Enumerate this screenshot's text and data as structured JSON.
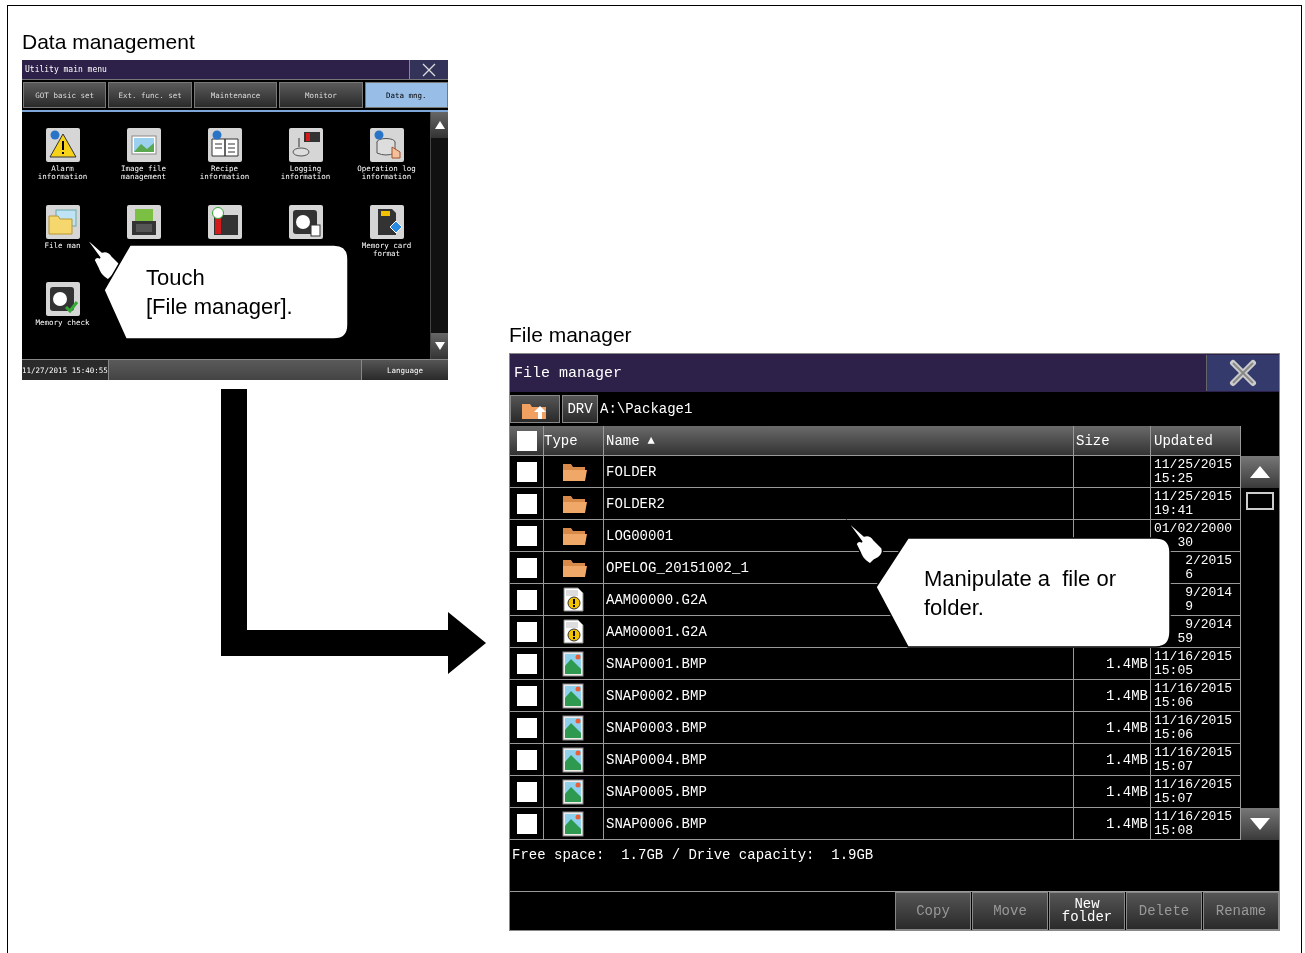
{
  "data_management": {
    "caption": "Data management",
    "screen": {
      "title": "Utility main menu",
      "tabs": [
        {
          "label": "GOT basic set",
          "selected": false
        },
        {
          "label": "Ext. func. set",
          "selected": false
        },
        {
          "label": "Maintenance",
          "selected": false
        },
        {
          "label": "Monitor",
          "selected": false
        },
        {
          "label": "Data mng.",
          "selected": true
        }
      ],
      "items": [
        {
          "kind": "alarm",
          "label": [
            "Alarm",
            "information"
          ]
        },
        {
          "kind": "image",
          "label": [
            "Image file",
            "management"
          ]
        },
        {
          "kind": "recipe",
          "label": [
            "Recipe",
            "information"
          ]
        },
        {
          "kind": "logging",
          "label": [
            "Logging",
            "information"
          ]
        },
        {
          "kind": "oplog",
          "label": [
            "Operation log",
            "information"
          ]
        },
        {
          "kind": "file",
          "label": [
            "File man"
          ]
        },
        {
          "kind": "hardcopy"
        },
        {
          "kind": "timer"
        },
        {
          "kind": "disk"
        },
        {
          "kind": "card",
          "label": [
            "Memory card",
            "format"
          ]
        },
        {
          "kind": "check",
          "label": [
            "Memory check"
          ]
        }
      ],
      "datetime": "11/27/2015 15:40:55",
      "language_button": "Language"
    },
    "callout": [
      "Touch",
      "[File manager]."
    ]
  },
  "file_manager": {
    "caption": "File manager",
    "screen": {
      "title": "File manager",
      "drive_button": "DRV",
      "path": "A:\\Package1",
      "select_all_checked": false,
      "columns": [
        "Type",
        "Name",
        "Size",
        "Updated"
      ],
      "sort_indicator": "▲",
      "rows": [
        {
          "kind": "folder",
          "checked": false,
          "name": "FOLDER",
          "updated": [
            "11/25/2015",
            "15:25"
          ]
        },
        {
          "kind": "folder",
          "checked": false,
          "name": "FOLDER2",
          "updated": [
            "11/25/2015",
            "19:41"
          ]
        },
        {
          "kind": "folder",
          "checked": false,
          "name": "LOG00001",
          "updated": [
            "01/02/2000",
            "30"
          ]
        },
        {
          "kind": "folder",
          "checked": false,
          "name": "OPELOG_20151002_1",
          "updated": [
            "2/2015",
            "6"
          ]
        },
        {
          "kind": "alarm-file",
          "checked": false,
          "name": "AAM00000.G2A",
          "updated": [
            "9/2014",
            "9"
          ]
        },
        {
          "kind": "alarm-file",
          "checked": false,
          "name": "AAM00001.G2A",
          "updated": [
            "9/2014",
            "59"
          ]
        },
        {
          "kind": "image-file",
          "checked": false,
          "name": "SNAP0001.BMP",
          "size": "1.4MB",
          "updated": [
            "11/16/2015",
            "15:05"
          ]
        },
        {
          "kind": "image-file",
          "checked": false,
          "name": "SNAP0002.BMP",
          "size": "1.4MB",
          "updated": [
            "11/16/2015",
            "15:06"
          ]
        },
        {
          "kind": "image-file",
          "checked": false,
          "name": "SNAP0003.BMP",
          "size": "1.4MB",
          "updated": [
            "11/16/2015",
            "15:06"
          ]
        },
        {
          "kind": "image-file",
          "checked": false,
          "name": "SNAP0004.BMP",
          "size": "1.4MB",
          "updated": [
            "11/16/2015",
            "15:07"
          ]
        },
        {
          "kind": "image-file",
          "checked": false,
          "name": "SNAP0005.BMP",
          "size": "1.4MB",
          "updated": [
            "11/16/2015",
            "15:07"
          ]
        },
        {
          "kind": "image-file",
          "checked": false,
          "name": "SNAP0006.BMP",
          "size": "1.4MB",
          "updated": [
            "11/16/2015",
            "15:08"
          ]
        }
      ],
      "disk_info": "Free space:  1.7GB / Drive capacity:  1.9GB",
      "buttons": [
        {
          "label": [
            "Copy"
          ],
          "disabled": true
        },
        {
          "label": [
            "Move"
          ],
          "disabled": true
        },
        {
          "label": [
            "New",
            "folder"
          ],
          "disabled": false
        },
        {
          "label": [
            "Delete"
          ],
          "disabled": true
        },
        {
          "label": [
            "Rename"
          ],
          "disabled": true
        }
      ]
    },
    "callout": [
      "Manipulate a  file or",
      "folder."
    ]
  }
}
